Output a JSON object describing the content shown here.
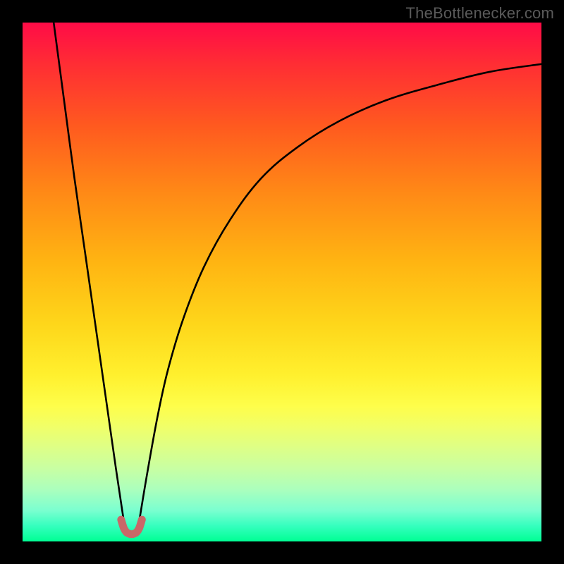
{
  "watermark": {
    "text": "TheBottlenecker.com"
  },
  "colors": {
    "frame": "#000000",
    "curve": "#000000",
    "marker": "#c96868",
    "gradient_top": "#ff0b47",
    "gradient_bottom": "#00ff94"
  },
  "chart_data": {
    "type": "line",
    "title": "",
    "xlabel": "",
    "ylabel": "",
    "xlim": [
      0,
      100
    ],
    "ylim": [
      0,
      100
    ],
    "annotations": [
      "TheBottlenecker.com"
    ],
    "series": [
      {
        "name": "left-branch",
        "x": [
          6,
          8,
          10,
          12,
          14,
          16,
          18,
          19.5
        ],
        "values": [
          100,
          85,
          70,
          56,
          42,
          28,
          14,
          4
        ]
      },
      {
        "name": "right-branch",
        "x": [
          22.5,
          24,
          26,
          28,
          31,
          35,
          40,
          46,
          53,
          61,
          70,
          80,
          90,
          100
        ],
        "values": [
          4,
          13,
          24,
          33,
          43,
          53,
          62,
          70,
          76,
          81,
          85,
          88,
          90.5,
          92
        ]
      },
      {
        "name": "minimum-marker",
        "x": [
          19,
          19.5,
          20,
          20.5,
          21,
          21.5,
          22,
          22.5,
          23
        ],
        "values": [
          4.2,
          2.6,
          1.8,
          1.5,
          1.4,
          1.5,
          1.8,
          2.6,
          4.2
        ]
      }
    ],
    "minimum_at_x": 21,
    "minimum_value": 1.4
  }
}
